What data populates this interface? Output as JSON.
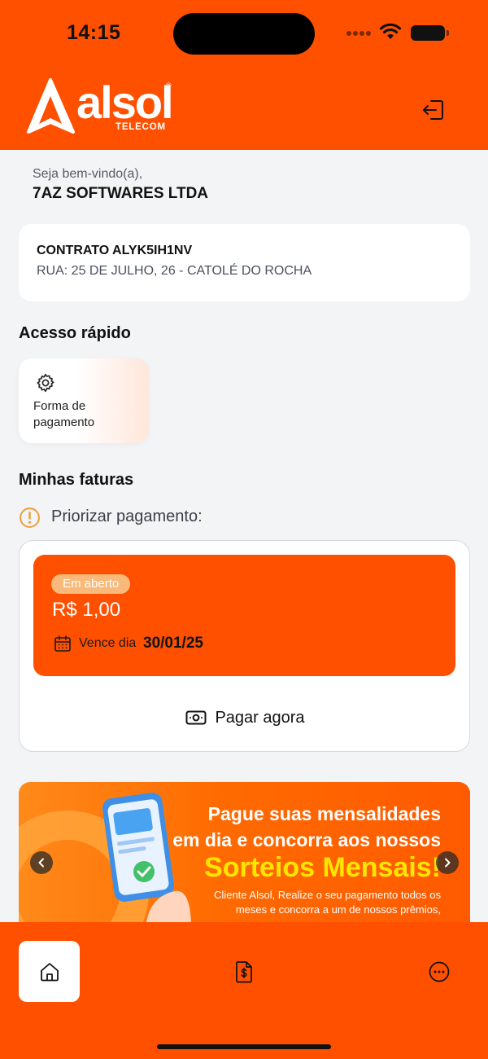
{
  "status_bar": {
    "time": "14:15"
  },
  "brand": {
    "name": "alsol",
    "reg": "®",
    "tagline": "TELECOM"
  },
  "welcome": {
    "label": "Seja bem-vindo(a),",
    "name": "7AZ SOFTWARES LTDA"
  },
  "contract": {
    "title": "CONTRATO ALYK5IH1NV",
    "address": "RUA: 25 DE JULHO, 26 - CATOLÉ DO ROCHA"
  },
  "quick_access": {
    "title": "Acesso rápido",
    "items": [
      {
        "label": "Forma de pagamento",
        "icon": "gear-icon"
      }
    ]
  },
  "invoices": {
    "title": "Minhas faturas",
    "priority_label": "Priorizar pagamento:",
    "current": {
      "status": "Em aberto",
      "amount": "R$ 1,00",
      "due_label": "Vence dia",
      "due_date": "30/01/25"
    },
    "pay_button": "Pagar agora"
  },
  "banner": {
    "line1": "Pague suas mensalidades",
    "line2": "em dia e concorra aos nossos",
    "line3": "Sorteios Mensais!",
    "small1": "Cliente Alsol, Realize o seu pagamento todos os",
    "small2": "meses e concorra a um de nossos prêmios,"
  },
  "colors": {
    "brand_orange": "#ff5000",
    "badge": "#f9b97a",
    "banner_highlight": "#ffe600",
    "warning": "#f0a040"
  },
  "nav": {
    "items": [
      {
        "name": "home",
        "icon": "home-icon",
        "active": true
      },
      {
        "name": "invoices",
        "icon": "invoice-dollar-icon",
        "active": false
      },
      {
        "name": "more",
        "icon": "more-icon",
        "active": false
      }
    ]
  }
}
